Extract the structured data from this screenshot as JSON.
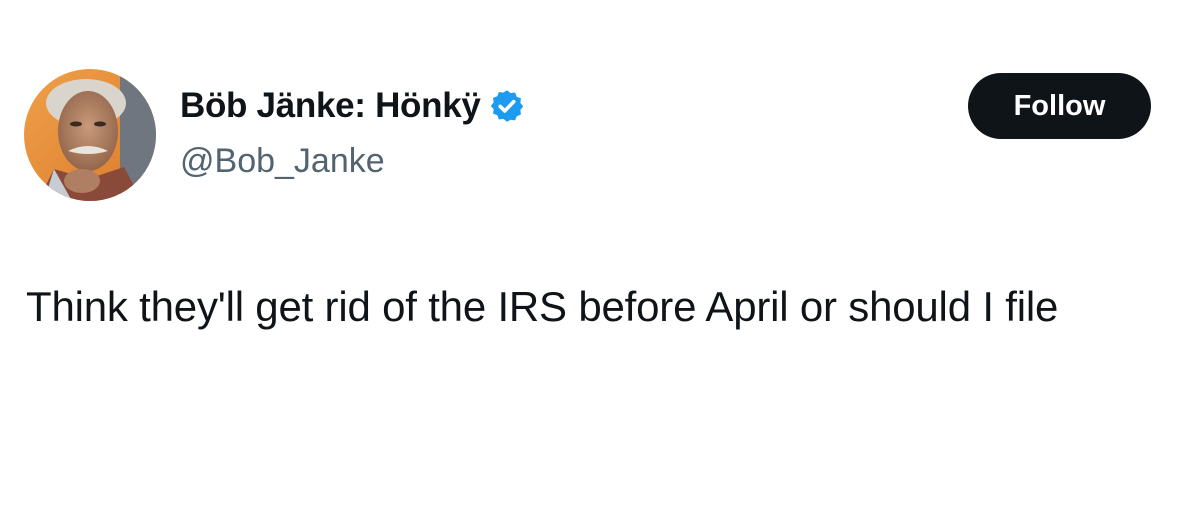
{
  "author": {
    "display_name": "Böb Jänke: Hönkÿ",
    "handle": "@Bob_Janke",
    "verified": true,
    "verified_color": "#1d9bf0",
    "avatar_icon": "profile-photo"
  },
  "actions": {
    "follow_label": "Follow"
  },
  "tweet": {
    "text": "Think they'll get rid of the IRS before April or should I file"
  },
  "colors": {
    "text_primary": "#0f1419",
    "text_secondary": "#536471",
    "button_bg": "#0f1419",
    "button_text": "#ffffff"
  }
}
